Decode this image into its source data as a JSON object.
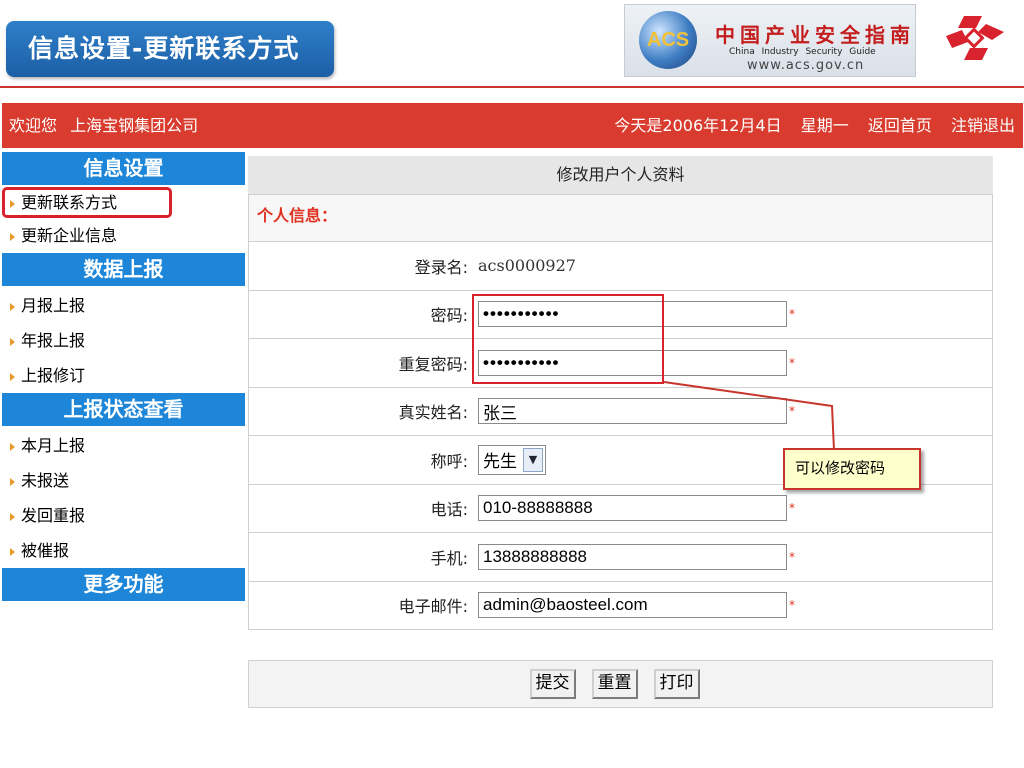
{
  "slide": {
    "title": "信息设置-更新联系方式",
    "logo": {
      "acs": "ACS",
      "cn": "中国产业安全指南",
      "en": "China  Industry  Security  Guide",
      "url": "www.acs.gov.cn"
    }
  },
  "header": {
    "welcome": "欢迎您",
    "company": "上海宝钢集团公司",
    "date": "今天是2006年12月4日",
    "weekday": "星期一",
    "home_link": "返回首页",
    "logout_link": "注销退出"
  },
  "sidebar": {
    "sections": [
      {
        "title": "信息设置",
        "items": [
          "更新联系方式",
          "更新企业信息"
        ]
      },
      {
        "title": "数据上报",
        "items": [
          "月报上报",
          "年报上报",
          "上报修订"
        ]
      },
      {
        "title": "上报状态查看",
        "items": [
          "本月上报",
          "未报送",
          "发回重报",
          "被催报"
        ]
      },
      {
        "title": "更多功能",
        "items": []
      }
    ],
    "active_item": "更新联系方式"
  },
  "form": {
    "title": "修改用户个人资料",
    "section": "个人信息：",
    "fields": {
      "login": {
        "label": "登录名:",
        "value": "acs0000927"
      },
      "password": {
        "label": "密码:",
        "value": "•••••••••••"
      },
      "password_repeat": {
        "label": "重复密码:",
        "value": "•••••••••••"
      },
      "real_name": {
        "label": "真实姓名:",
        "value": "张三"
      },
      "salutation": {
        "label": "称呼:",
        "value": "先生"
      },
      "phone": {
        "label": "电话:",
        "value": "010-88888888"
      },
      "mobile": {
        "label": "手机:",
        "value": "13888888888"
      },
      "email": {
        "label": "电子邮件:",
        "value": "admin@baosteel.com"
      }
    },
    "required_mark": "*",
    "buttons": {
      "submit": "提交",
      "reset": "重置",
      "print": "打印"
    }
  },
  "annotation": {
    "callout": "可以修改密码"
  },
  "colors": {
    "header_red": "#d93b2e",
    "sidebar_blue": "#1d86d8",
    "title_blue": "#2f7fc9",
    "required": "#e0301f"
  }
}
